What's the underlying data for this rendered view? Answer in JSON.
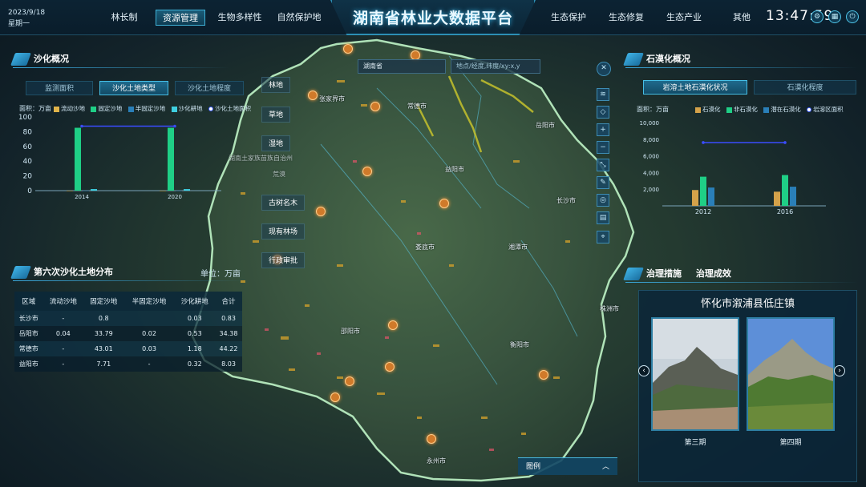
{
  "header": {
    "date": "2023/9/18",
    "weekday": "星期一",
    "title": "湖南省林业大数据平台",
    "clock": "13:47:59",
    "nav_left": [
      "林长制",
      "资源管理",
      "生物多样性",
      "自然保护地"
    ],
    "nav_right": [
      "生态保护",
      "生态修复",
      "生态产业",
      "其他"
    ],
    "active_nav": "资源管理",
    "icons": [
      "settings-icon",
      "grid-icon",
      "power-icon"
    ]
  },
  "desert_panel": {
    "title": "沙化概况",
    "tabs": [
      "监测面积",
      "沙化土地类型",
      "沙化土地程度"
    ],
    "active_tab": "沙化土地类型",
    "unit": "面积：万亩",
    "legend": [
      "流动沙地",
      "固定沙地",
      "半固定沙地",
      "沙化耕地",
      "沙化土地面积"
    ]
  },
  "table_panel": {
    "title": "第六次沙化土地分布",
    "unit": "单位：万亩",
    "columns": [
      "区域",
      "流动沙地",
      "固定沙地",
      "半固定沙地",
      "沙化耕地",
      "合计"
    ],
    "rows": [
      [
        "长沙市",
        "-",
        "0.8",
        "",
        "0.03",
        "0.83"
      ],
      [
        "岳阳市",
        "0.04",
        "33.79",
        "0.02",
        "0.53",
        "34.38"
      ],
      [
        "常德市",
        "-",
        "43.01",
        "0.03",
        "1.18",
        "44.22"
      ],
      [
        "益阳市",
        "-",
        "7.71",
        "-",
        "0.32",
        "8.03"
      ]
    ]
  },
  "rock_panel": {
    "title": "石漠化概况",
    "tabs": [
      "岩溶土地石漠化状况",
      "石漠化程度"
    ],
    "active_tab": "岩溶土地石漠化状况",
    "unit": "面积：万亩",
    "legend": [
      "石漠化",
      "非石漠化",
      "潜在石漠化",
      "岩溶区面积"
    ]
  },
  "governance_panel": {
    "tabs": [
      "治理措施",
      "治理成效"
    ],
    "place": "怀化市溆浦县低庄镇",
    "captions": [
      "第三期",
      "第四期"
    ]
  },
  "map": {
    "search_region": "湖南省",
    "search_placeholder": "地点/经度,纬度/xy:x,y",
    "layers": [
      "林地",
      "草地",
      "湿地",
      "古树名木",
      "现有林场",
      "行政审批"
    ],
    "faded_labels": [
      "湖南土家族苗族自治州",
      "荒漠"
    ],
    "cities": [
      "张家界市",
      "常德市",
      "岳阳市",
      "益阳市",
      "长沙市",
      "娄底市",
      "湘潭市",
      "株洲市",
      "邵阳市",
      "衡阳市",
      "永州市"
    ],
    "legend_label": "图例",
    "tools": [
      "layers-icon",
      "compass-icon",
      "zoom-in-icon",
      "zoom-out-icon",
      "measure-icon",
      "draw-icon",
      "globe-icon",
      "print-icon",
      "locate-icon"
    ]
  },
  "chart_data": [
    {
      "type": "bar",
      "title": "",
      "categories": [
        "2014",
        "2020"
      ],
      "ylim": [
        0,
        100
      ],
      "yticks": [
        0,
        20,
        40,
        60,
        80,
        100
      ],
      "series": [
        {
          "name": "流动沙地",
          "values": [
            0.04,
            0.04
          ],
          "color": "#e0b34a"
        },
        {
          "name": "固定沙地",
          "values": [
            85.3,
            85.3
          ],
          "color": "#1fcf86"
        },
        {
          "name": "半固定沙地",
          "values": [
            0.05,
            0.05
          ],
          "color": "#2a7fb8"
        },
        {
          "name": "沙化耕地",
          "values": [
            2.1,
            2.1
          ],
          "color": "#3fcfe0"
        },
        {
          "name": "沙化土地面积",
          "values": [
            87.5,
            87.5
          ],
          "color": "#3a4cff",
          "kind": "line"
        }
      ]
    },
    {
      "type": "bar",
      "title": "",
      "categories": [
        "2012",
        "2016"
      ],
      "ylim": [
        0,
        10000
      ],
      "yticks": [
        "2,000",
        "4,000",
        "6,000",
        "8,000",
        "10,000"
      ],
      "series": [
        {
          "name": "石漠化",
          "values": [
            1900,
            1700
          ],
          "color": "#d4a24a"
        },
        {
          "name": "非石漠化",
          "values": [
            3500,
            3700
          ],
          "color": "#1fcf86"
        },
        {
          "name": "潜在石漠化",
          "values": [
            2200,
            2300
          ],
          "color": "#2a7fb8"
        },
        {
          "name": "岩溶区面积",
          "values": [
            7600,
            7600
          ],
          "color": "#3a4cff",
          "kind": "line"
        }
      ]
    }
  ]
}
